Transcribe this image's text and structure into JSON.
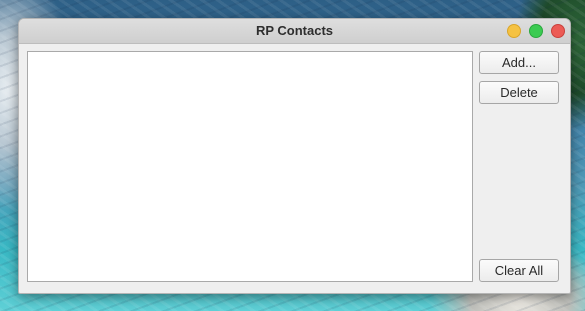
{
  "window": {
    "title": "RP Contacts"
  },
  "buttons": {
    "add_label": "Add...",
    "delete_label": "Delete",
    "clear_all_label": "Clear All"
  },
  "contacts": [],
  "colors": {
    "minimize": "#f5c242",
    "maximize": "#3ccb52",
    "close": "#ec5b55"
  }
}
